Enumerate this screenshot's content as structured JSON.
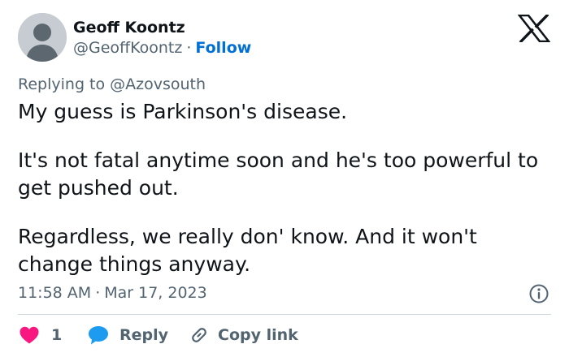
{
  "author": {
    "display_name": "Geoff Koontz",
    "handle": "@GeoffKoontz",
    "separator": "·",
    "follow_label": "Follow"
  },
  "reply_context": "Replying to @Azovsouth",
  "tweet": {
    "paragraphs": [
      "My guess is Parkinson's disease.",
      "It's not fatal anytime soon and he's too powerful to get pushed out.",
      "Regardless, we really don' know.  And it won't change things anyway."
    ]
  },
  "meta": {
    "time": "11:58 AM",
    "separator": "·",
    "date": "Mar 17, 2023"
  },
  "actions": {
    "like_count": "1",
    "reply_label": "Reply",
    "copy_link_label": "Copy link"
  },
  "icons": {
    "brand": "x-logo-icon",
    "info": "info-icon",
    "like": "heart-icon",
    "reply": "speech-bubble-icon",
    "copy": "link-icon"
  },
  "colors": {
    "text": "#0f1419",
    "secondary_text": "#536471",
    "link": "#006fd6",
    "like": "#f91880",
    "reply": "#1d9bf0",
    "divider": "#cfd9de",
    "avatar": "#c6ccd1"
  }
}
